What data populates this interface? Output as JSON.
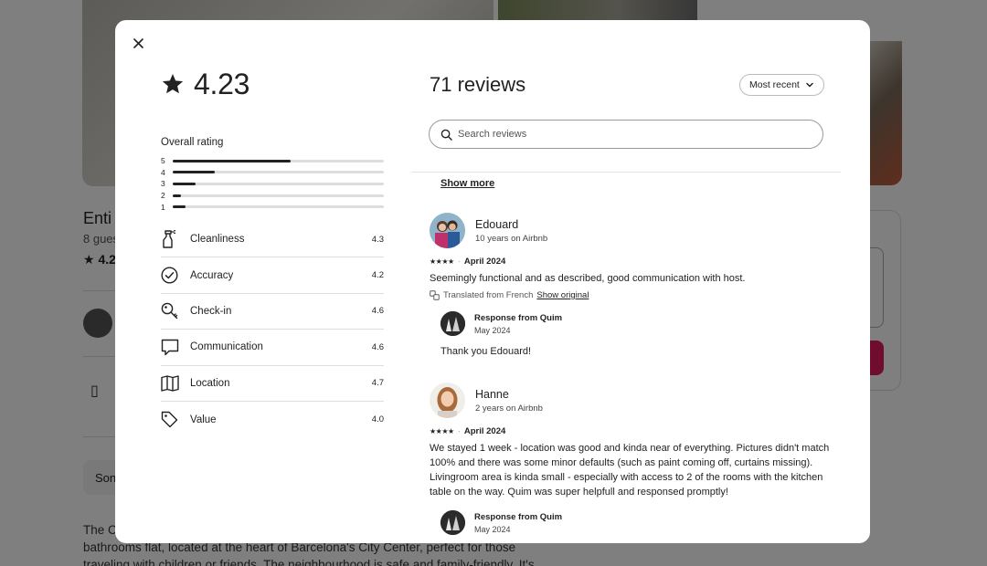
{
  "background": {
    "listing_title_fragment": "Enti",
    "guests_fragment": "8 gues",
    "rating_fragment": "4.2",
    "button_fragment": "Son",
    "description_lines": [
      "The C",
      "bathrooms flat, located at the heart of Barcelona's City Center, perfect for those",
      "traveling with children or friends. The neighbourhood is safe and family-friendly. It's"
    ]
  },
  "modal": {
    "overall_score": "4.23",
    "overall_label": "Overall rating",
    "distribution": [
      {
        "stars": "5",
        "fraction": 0.56
      },
      {
        "stars": "4",
        "fraction": 0.2
      },
      {
        "stars": "3",
        "fraction": 0.11
      },
      {
        "stars": "2",
        "fraction": 0.04
      },
      {
        "stars": "1",
        "fraction": 0.06
      }
    ],
    "categories": [
      {
        "name": "Cleanliness",
        "value": "4.3",
        "icon": "spray-bottle-icon"
      },
      {
        "name": "Accuracy",
        "value": "4.2",
        "icon": "check-circle-icon"
      },
      {
        "name": "Check-in",
        "value": "4.6",
        "icon": "key-icon"
      },
      {
        "name": "Communication",
        "value": "4.6",
        "icon": "chat-bubble-icon"
      },
      {
        "name": "Location",
        "value": "4.7",
        "icon": "map-icon"
      },
      {
        "name": "Value",
        "value": "4.0",
        "icon": "tag-icon"
      }
    ],
    "reviews_title": "71 reviews",
    "sort_label": "Most recent",
    "search_placeholder": "Search reviews",
    "show_more": "Show more",
    "reviews": [
      {
        "name": "Edouard",
        "tenure": "10 years on Airbnb",
        "stars": 4,
        "date": "April 2024",
        "text": "Seemingly functional and as described, good communication with host.",
        "translated_label": "Translated from French",
        "show_original": "Show original",
        "response": {
          "from": "Response from Quim",
          "date": "May 2024",
          "text": "Thank you Edouard!"
        }
      },
      {
        "name": "Hanne",
        "tenure": "2 years on Airbnb",
        "stars": 4,
        "date": "April 2024",
        "text": "We stayed 1 week - location was good and kinda near of everything. Pictures didn't match 100% and there was some minor defaults (such as paint coming off, curtains missing). Livingroom area is kinda small - especially with access to 2 of the rooms with the kitchen table on the way. Quim was super helpfull and responsed promptly!",
        "response": {
          "from": "Response from Quim",
          "date": "May 2024"
        }
      }
    ]
  },
  "colors": {
    "accent": "#e0195a",
    "text": "#222222",
    "divider": "#dddddd"
  }
}
